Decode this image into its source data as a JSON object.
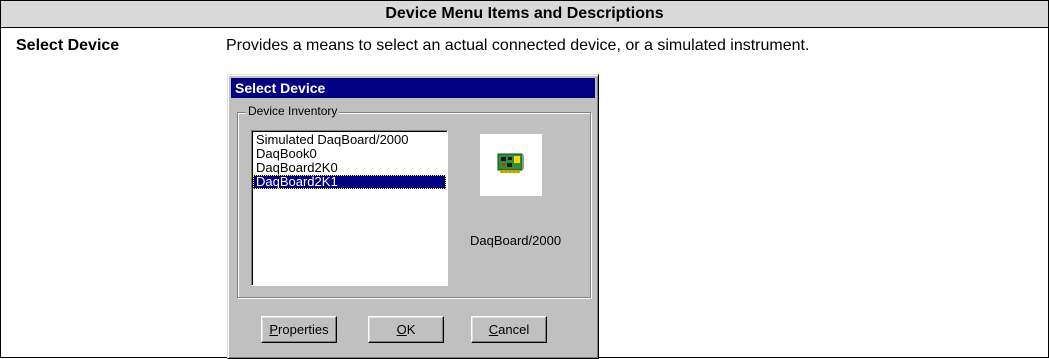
{
  "table": {
    "header": "Device Menu Items and Descriptions",
    "rows": [
      {
        "label": "Select Device",
        "description": "Provides a means to select an actual connected device, or a simulated instrument."
      }
    ]
  },
  "dialog": {
    "title": "Select Device",
    "group_label": "Device Inventory",
    "devices": [
      "Simulated DaqBoard/2000",
      "DaqBook0",
      "DaqBoard2K0",
      "DaqBoard2K1"
    ],
    "selected_index": 3,
    "device_image_icon": "pci-board-icon",
    "device_image_label": "DaqBoard/2000",
    "buttons": {
      "properties_label": "Properties",
      "ok_label": "OK",
      "cancel_label": "Cancel"
    }
  },
  "colors": {
    "header_bg": "#d9d9d9",
    "dialog_bg": "#c0c0c0",
    "titlebar_bg": "#000080",
    "selection_bg": "#000080"
  }
}
